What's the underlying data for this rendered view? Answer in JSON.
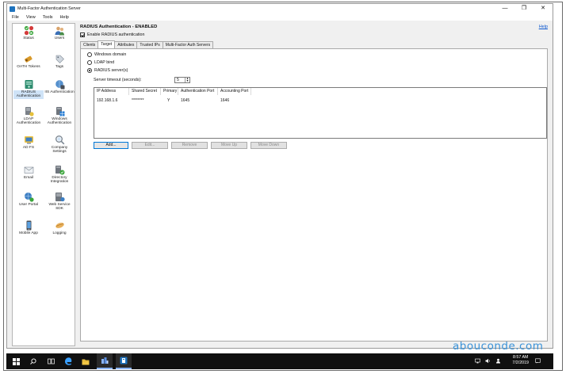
{
  "window": {
    "title": "Multi-Factor Authentication Server",
    "controls": {
      "minimize": "—",
      "maximize": "❐",
      "close": "✕"
    }
  },
  "menu": [
    "File",
    "View",
    "Tools",
    "Help"
  ],
  "sidebar": {
    "items": [
      {
        "label": "Status",
        "icon": "status-icon"
      },
      {
        "label": "Users",
        "icon": "users-icon"
      },
      {
        "label": "OATH Tokens",
        "icon": "oath-tokens-icon"
      },
      {
        "label": "Tags",
        "icon": "tags-icon"
      },
      {
        "label": "RADIUS Authentication",
        "icon": "radius-icon",
        "active": true
      },
      {
        "label": "IIS Authentication",
        "icon": "iis-icon"
      },
      {
        "label": "LDAP Authentication",
        "icon": "ldap-icon"
      },
      {
        "label": "Windows Authentication",
        "icon": "windows-auth-icon"
      },
      {
        "label": "AD FS",
        "icon": "adfs-icon"
      },
      {
        "label": "Company Settings",
        "icon": "company-settings-icon"
      },
      {
        "label": "Email",
        "icon": "email-icon"
      },
      {
        "label": "Directory Integration",
        "icon": "directory-integration-icon"
      },
      {
        "label": "User Portal",
        "icon": "user-portal-icon"
      },
      {
        "label": "Web Service SDK",
        "icon": "web-service-sdk-icon"
      },
      {
        "label": "Mobile App",
        "icon": "mobile-app-icon"
      },
      {
        "label": "Logging",
        "icon": "logging-icon"
      }
    ]
  },
  "main": {
    "title": "RADIUS Authentication - ENABLED",
    "help": "Help",
    "enable_label": "Enable RADIUS authentication",
    "enable_checked": true,
    "tabs": [
      "Clients",
      "Target",
      "Attributes",
      "Trusted IPs",
      "Multi-Factor Auth Servers"
    ],
    "active_tab": "Target",
    "radios": [
      {
        "label": "Windows domain",
        "selected": false
      },
      {
        "label": "LDAP bind",
        "selected": false
      },
      {
        "label": "RADIUS server(s)",
        "selected": true
      }
    ],
    "timeout_label": "Server timeout (seconds):",
    "timeout_value": "5",
    "columns": [
      "IP Address",
      "Shared Secret",
      "Primary",
      "Authentication Port",
      "Accounting Port"
    ],
    "rows": [
      [
        "192.168.1.6",
        "********",
        "Y",
        "1645",
        "1646"
      ]
    ],
    "buttons": [
      "Add...",
      "Edit...",
      "Remove",
      "Move Up",
      "Move Down"
    ]
  },
  "taskbar": {
    "time": "8:57 AM",
    "date": "7/2/2019"
  },
  "watermark": "abouconde.com",
  "colors": {
    "accent": "#0078d7",
    "taskbar": "#101010",
    "watermark": "#3a92d8"
  }
}
